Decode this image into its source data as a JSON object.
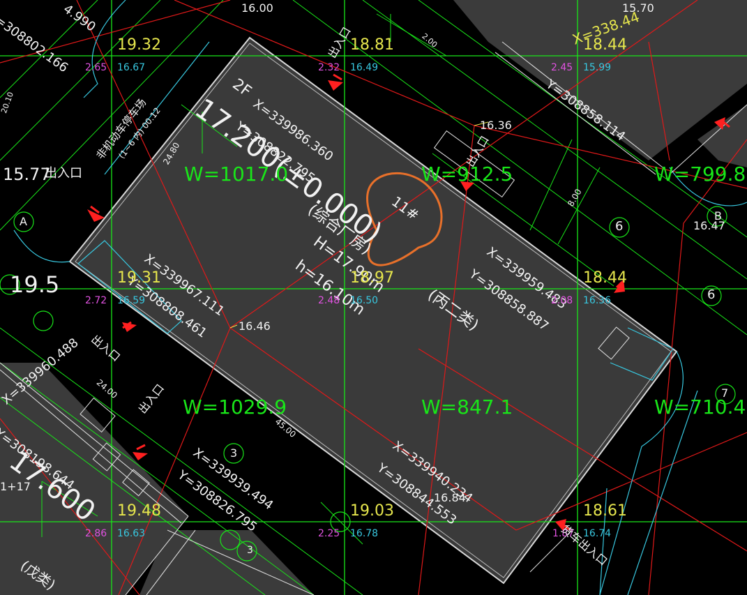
{
  "grid_elevations": [
    {
      "main": "19.32",
      "a": "2.65",
      "b": "16.67"
    },
    {
      "main": "18.81",
      "a": "2.32",
      "b": "16.49"
    },
    {
      "main": "18.44",
      "a": "2.45",
      "b": "15.99"
    },
    {
      "main": "19.31",
      "a": "2.72",
      "b": "16.59"
    },
    {
      "main": "18.97",
      "a": "2.48",
      "b": "16.50"
    },
    {
      "main": "18.44",
      "a": "2.08",
      "b": "16.36"
    },
    {
      "main": "19.48",
      "a": "2.86",
      "b": "16.63"
    },
    {
      "main": "19.03",
      "a": "2.25",
      "b": "16.78"
    },
    {
      "main": "18.61",
      "a": "1.87",
      "b": "16.74"
    }
  ],
  "w_values": [
    "W=1017.0",
    "W=912.5",
    "W=799.8",
    "W=1029.9",
    "W=847.1",
    "W=710.4"
  ],
  "point_elev": [
    "16.36",
    "16.47",
    "16.46",
    "16.84",
    "16.00",
    "15.70",
    "15.77",
    "19.5"
  ],
  "coords": {
    "c1": "X=339986.360",
    "c2": "Y=308822.795",
    "c3": "X=339959.483",
    "c4": "Y=308858.887",
    "c5": "X=339967.111",
    "c6": "Y=308808.461",
    "c7": "X=339940.234",
    "c8": "Y=308844.553",
    "c9": "X=339939.494",
    "c10": "Y=308826.795",
    "c11": "X=338.44",
    "c12": "Y=308858.114",
    "c13": "X=339960.488",
    "c14": "Y=308198.644",
    "c15": "=308802.166",
    "c16": "4.990"
  },
  "building": {
    "floors": "2F",
    "big_label": "17.200(±0.000)",
    "room": "(综合厂房)",
    "height_H": "H=17.90m",
    "height_h": "h=16.10m",
    "cls": "(丙二类)",
    "number": "11#"
  },
  "labels": {
    "entrance": "出入口",
    "entrance2": "出入口",
    "entrance3": "出入口",
    "entrance4": "出入口",
    "entrance5": "出入口",
    "vehicle": "货车出入口",
    "parking": "非机动车停车场",
    "parking_area": "(1~6 内) 00.12",
    "a": "A",
    "b": "B",
    "num3": "3",
    "num6a": "6",
    "num6b": "6",
    "num7": "7",
    "dim24": "24.00",
    "dim2480": "24.80",
    "dim4500": "45.00",
    "dim800": "8.00",
    "dim1600": "2.00",
    "wu": "(戊类)",
    "big600": "17.600",
    "bigLeft": "19.5",
    "cut1": "1+17",
    "cut2": "20.10",
    "num3b": "3"
  },
  "colors": {
    "grid": "#19e619",
    "build": "#3a3a3a",
    "red": "#e01919",
    "cyan": "#38c8e0",
    "orange": "#e8702a"
  }
}
